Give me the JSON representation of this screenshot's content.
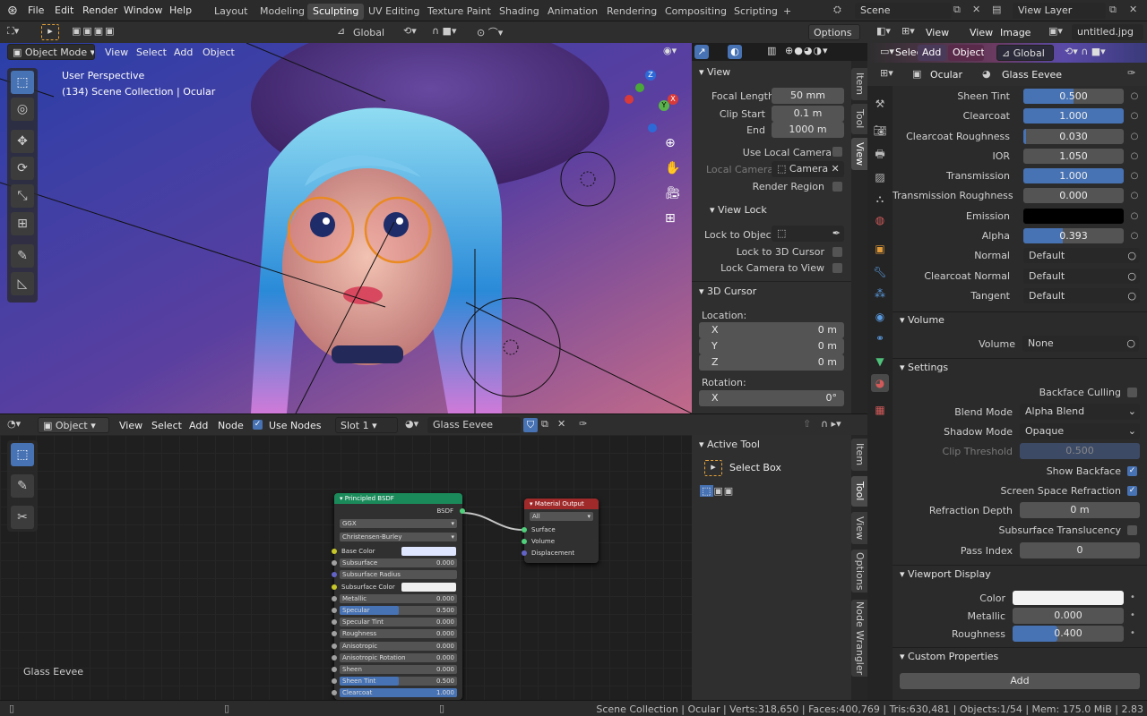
{
  "menubar": {
    "items": [
      "File",
      "Edit",
      "Render",
      "Window",
      "Help"
    ]
  },
  "workspaces": {
    "tabs": [
      "Layout",
      "Modeling",
      "Sculpting",
      "UV Editing",
      "Texture Paint",
      "Shading",
      "Animation",
      "Rendering",
      "Compositing",
      "Scripting",
      "+"
    ],
    "active": "Sculpting"
  },
  "scene": {
    "name": "Scene",
    "view_layer": "View Layer"
  },
  "viewport_header": {
    "mode": "Object Mode",
    "menus": [
      "View",
      "Select",
      "Add",
      "Object"
    ],
    "transform": "Global",
    "options": "Options"
  },
  "viewport_overlay": {
    "perspective": "User Perspective",
    "collection": "(134) Scene Collection | Ocular"
  },
  "npanel": {
    "tabs": [
      "Item",
      "Tool",
      "View"
    ],
    "view_title": "View",
    "focal_length_label": "Focal Length",
    "focal_length": "50 mm",
    "clip_start_label": "Clip Start",
    "clip_start": "0.1 m",
    "end_label": "End",
    "end": "1000 m",
    "use_local_camera": "Use Local Camera",
    "local_camera": "Local Camera",
    "camera": "Camera",
    "render_region": "Render Region",
    "view_lock_title": "View Lock",
    "lock_to_object": "Lock to Object",
    "lock_3d_cursor": "Lock to 3D Cursor",
    "lock_camera": "Lock Camera to View",
    "cursor_title": "3D Cursor",
    "location": "Location:",
    "x": "X",
    "y": "Y",
    "z": "Z",
    "loc_x": "0 m",
    "loc_y": "0 m",
    "loc_z": "0 m",
    "rotation": "Rotation:",
    "rot_x": "0°"
  },
  "node_header": {
    "editor": "Object",
    "menus": [
      "View",
      "Select",
      "Add",
      "Node"
    ],
    "use_nodes": "Use Nodes",
    "slot": "Slot 1",
    "material": "Glass Eevee"
  },
  "node_sidebar": {
    "title": "Active Tool",
    "tool": "Select Box",
    "tabs": [
      "Item",
      "Tool",
      "View",
      "Options",
      "Node Wrangler"
    ]
  },
  "node_label": "Glass Eevee",
  "bsdf": {
    "title": "Principled BSDF",
    "out": "BSDF",
    "dist": "GGX",
    "ss_method": "Christensen-Burley",
    "rows": [
      {
        "name": "Base Color",
        "value": "",
        "color": "#dfe6ff"
      },
      {
        "name": "Subsurface",
        "value": "0.000"
      },
      {
        "name": "Subsurface Radius",
        "value": ""
      },
      {
        "name": "Subsurface Color",
        "value": "",
        "color": "#f0f0f0"
      },
      {
        "name": "Metallic",
        "value": "0.000"
      },
      {
        "name": "Specular",
        "value": "0.500",
        "fill": 0.5
      },
      {
        "name": "Specular Tint",
        "value": "0.000"
      },
      {
        "name": "Roughness",
        "value": "0.000"
      },
      {
        "name": "Anisotropic",
        "value": "0.000"
      },
      {
        "name": "Anisotropic Rotation",
        "value": "0.000"
      },
      {
        "name": "Sheen",
        "value": "0.000"
      },
      {
        "name": "Sheen Tint",
        "value": "0.500",
        "fill": 0.5
      },
      {
        "name": "Clearcoat",
        "value": "1.000",
        "fill": 1.0
      }
    ]
  },
  "material_output": {
    "title": "Material Output",
    "target": "All",
    "sockets": [
      "Surface",
      "Volume",
      "Displacement"
    ]
  },
  "image_header": {
    "menus": [
      "View",
      "View",
      "Image"
    ],
    "file": "untitled.jpg",
    "sel_menus": [
      "Select",
      "Add",
      "Object"
    ],
    "transform": "Global"
  },
  "properties": {
    "object": "Ocular",
    "material": "Glass Eevee",
    "rows": [
      {
        "label": "Sheen Tint",
        "value": "0.500",
        "fill": 0.5
      },
      {
        "label": "Clearcoat",
        "value": "1.000",
        "fill": 1.0
      },
      {
        "label": "Clearcoat Roughness",
        "value": "0.030",
        "fill": 0.03
      },
      {
        "label": "IOR",
        "value": "1.050",
        "fill": 0
      },
      {
        "label": "Transmission",
        "value": "1.000",
        "fill": 1.0
      },
      {
        "label": "Transmission Roughness",
        "value": "0.000",
        "fill": 0
      },
      {
        "label": "Emission",
        "value": "",
        "color": "#000000"
      },
      {
        "label": "Alpha",
        "value": "0.393",
        "fill": 0.393
      },
      {
        "label": "Normal",
        "value": "Default",
        "link": true
      },
      {
        "label": "Clearcoat Normal",
        "value": "Default",
        "link": true
      },
      {
        "label": "Tangent",
        "value": "Default",
        "link": true
      }
    ],
    "volume_title": "Volume",
    "volume_label": "Volume",
    "volume_value": "None",
    "settings_title": "Settings",
    "backface_culling": "Backface Culling",
    "blend_mode_label": "Blend Mode",
    "blend_mode": "Alpha Blend",
    "shadow_mode_label": "Shadow Mode",
    "shadow_mode": "Opaque",
    "clip_threshold_label": "Clip Threshold",
    "clip_threshold": "0.500",
    "show_backface": "Show Backface",
    "ssr": "Screen Space Refraction",
    "refraction_depth_label": "Refraction Depth",
    "refraction_depth": "0 m",
    "sss_translucency": "Subsurface Translucency",
    "pass_index_label": "Pass Index",
    "pass_index": "0",
    "viewport_display_title": "Viewport Display",
    "vd_color_label": "Color",
    "vd_color": "#f2f2f2",
    "vd_metallic_label": "Metallic",
    "vd_metallic": "0.000",
    "vd_roughness_label": "Roughness",
    "vd_roughness": "0.400",
    "vd_roughness_fill": 0.4,
    "custom_props_title": "Custom Properties",
    "add": "Add"
  },
  "status": {
    "text": "Scene Collection | Ocular | Verts:318,650 | Faces:400,769 | Tris:630,481 | Objects:1/54 | Mem: 175.0 MiB | 2.83"
  },
  "colors": {
    "accent": "#4772b3",
    "bsdf_header": "#1b8a5a",
    "output_header": "#a02a2a"
  }
}
